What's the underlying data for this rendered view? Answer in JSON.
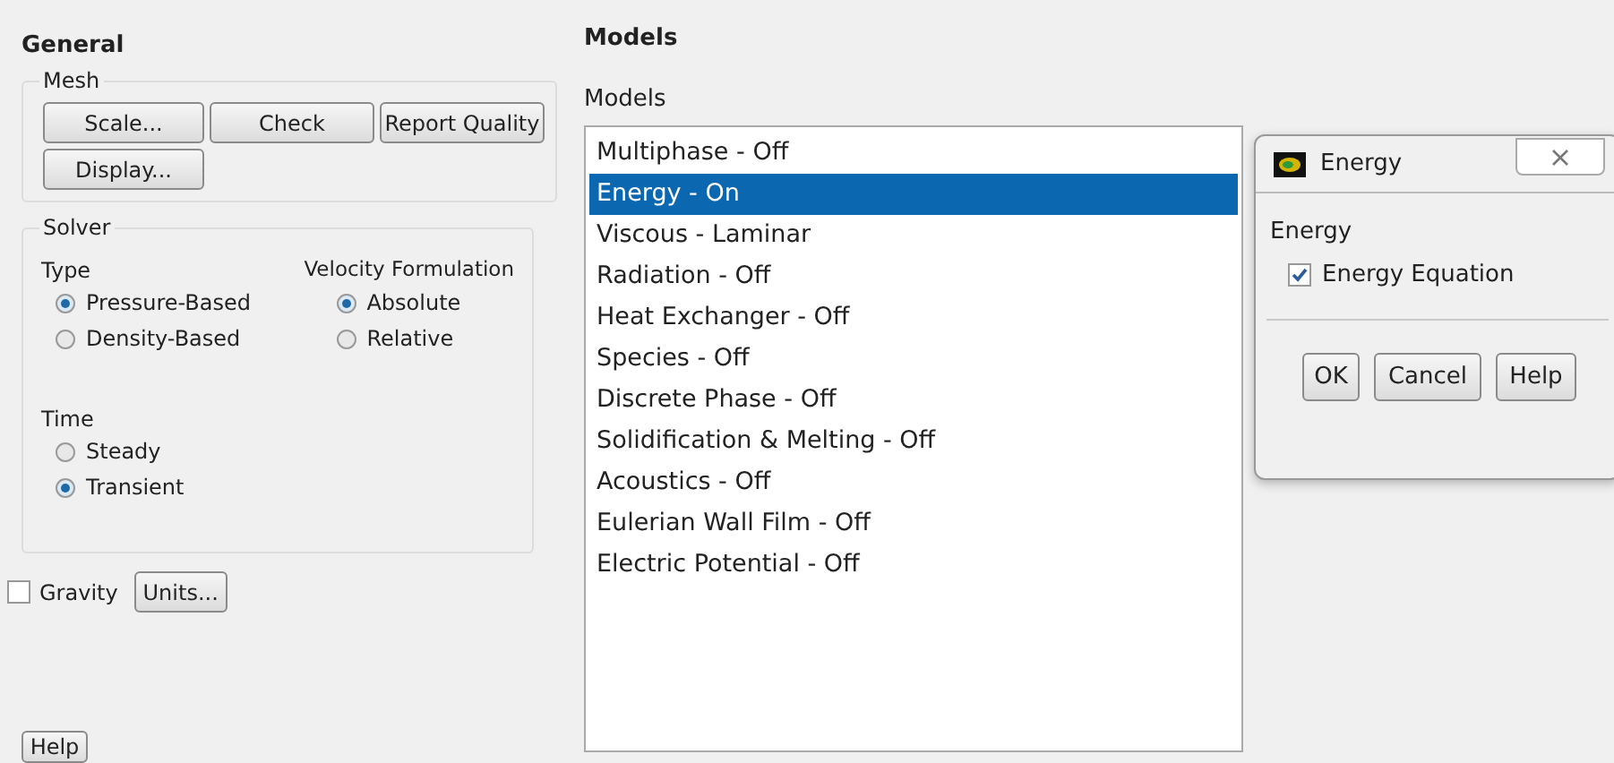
{
  "general": {
    "title": "General",
    "mesh": {
      "label": "Mesh",
      "buttons": [
        "Scale...",
        "Check",
        "Report Quality",
        "Display..."
      ]
    },
    "solver": {
      "label": "Solver",
      "type": {
        "label": "Type",
        "options": [
          {
            "label": "Pressure-Based",
            "selected": true
          },
          {
            "label": "Density-Based",
            "selected": false
          }
        ]
      },
      "velocity_formulation": {
        "label": "Velocity Formulation",
        "options": [
          {
            "label": "Absolute",
            "selected": true
          },
          {
            "label": "Relative",
            "selected": false
          }
        ]
      },
      "time": {
        "label": "Time",
        "options": [
          {
            "label": "Steady",
            "selected": false
          },
          {
            "label": "Transient",
            "selected": true
          }
        ]
      }
    },
    "gravity": {
      "label": "Gravity",
      "checked": false
    },
    "units_button": "Units...",
    "help_button": "Help"
  },
  "models": {
    "title": "Models",
    "list_label": "Models",
    "items": [
      {
        "label": "Multiphase - Off",
        "selected": false
      },
      {
        "label": "Energy - On",
        "selected": true
      },
      {
        "label": "Viscous - Laminar",
        "selected": false
      },
      {
        "label": "Radiation - Off",
        "selected": false
      },
      {
        "label": "Heat Exchanger - Off",
        "selected": false
      },
      {
        "label": "Species - Off",
        "selected": false
      },
      {
        "label": "Discrete Phase - Off",
        "selected": false
      },
      {
        "label": "Solidification & Melting - Off",
        "selected": false
      },
      {
        "label": "Acoustics - Off",
        "selected": false
      },
      {
        "label": "Eulerian Wall Film - Off",
        "selected": false
      },
      {
        "label": "Electric Potential - Off",
        "selected": false
      }
    ]
  },
  "dialog": {
    "title": "Energy",
    "group_label": "Energy",
    "option": {
      "label": "Energy Equation",
      "checked": true
    },
    "buttons": [
      "OK",
      "Cancel",
      "Help"
    ]
  }
}
